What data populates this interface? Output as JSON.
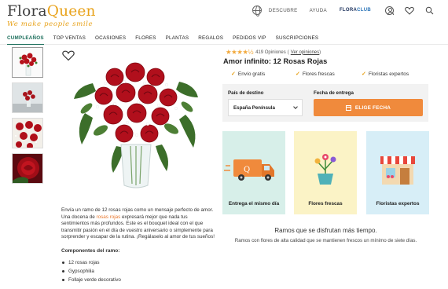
{
  "brand": {
    "name_part1": "Flora",
    "name_part2": "Queen",
    "tagline": "We make people smile",
    "accent": "#e8a21a"
  },
  "top_bar": {
    "discover": "DESCUBRE",
    "help": "AYUDA",
    "club_part1": "FLORA",
    "club_part2": "CLUB"
  },
  "nav": {
    "items": [
      "CUMPLEAÑOS",
      "TOP VENTAS",
      "OCASIONES",
      "FLORES",
      "PLANTAS",
      "REGALOS",
      "PEDIDOS VIP",
      "SUSCRIPCIONES"
    ],
    "active_color": "#1b6e5b"
  },
  "product": {
    "rating_stars": "★★★★½",
    "rating_value": 4.5,
    "opinions_count": "419 Opiniones",
    "opinions_link": "Ver opiniones",
    "title": "Amor infinito: 12 Rosas Rojas",
    "badges": [
      "Envío gratis",
      "Flores frescas",
      "Floristas expertos"
    ],
    "delivery": {
      "destination_label": "País de destino",
      "destination_value": "España Península",
      "date_label": "Fecha de entrega",
      "date_button": "ELIGE FECHA",
      "button_color": "#f08a3c"
    },
    "description_1": "Envía un ramo de 12 rosas rojas como un mensaje perfecto de amor. Una docena de ",
    "description_link": "rosas rojas",
    "description_2": " expresará mejor que nada tus sentimientos más profundos. Este es el bouquet ideal con el que transmitir pasión en el día de vuestro aniversario o simplemente para sorprender y escapar de la rutina. ¡Regálaselo al amor de tus sueños!",
    "components_title": "Componentes del ramo:",
    "components": [
      "12 rosas rojas",
      "Gypsophilia",
      "Follaje verde decorativo"
    ]
  },
  "features": {
    "cards": [
      {
        "caption": "Entrega el mismo día",
        "bg": "#d7efe9"
      },
      {
        "caption": "Flores frescas",
        "bg": "#fbf3c6"
      },
      {
        "caption": "Floristas expertos",
        "bg": "#d7eef7"
      }
    ],
    "headline": "Ramos que se disfrutan más tiempo.",
    "subline": "Ramos con flores de alta calidad que se mantienen frescos un mínimo de siete días."
  }
}
